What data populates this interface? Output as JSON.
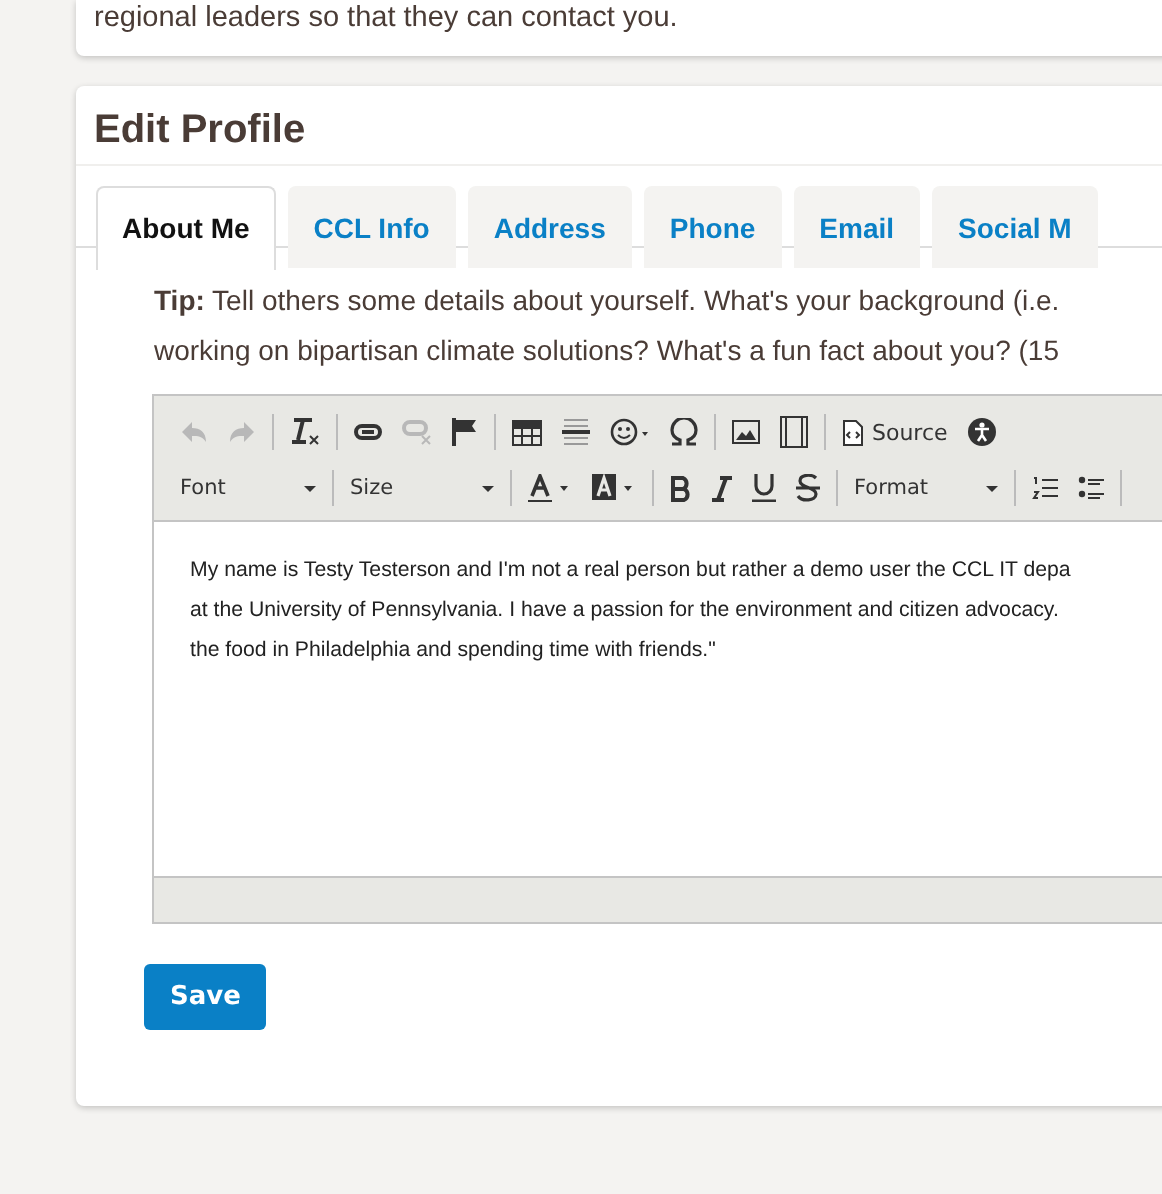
{
  "intro_card": {
    "text": "regional leaders so that they can contact you."
  },
  "edit_profile": {
    "title": "Edit Profile",
    "tabs": [
      {
        "label": "About Me",
        "selected": true
      },
      {
        "label": "CCL Info",
        "selected": false
      },
      {
        "label": "Address",
        "selected": false
      },
      {
        "label": "Phone",
        "selected": false
      },
      {
        "label": "Email",
        "selected": false
      },
      {
        "label": "Social M",
        "selected": false
      }
    ],
    "tip_lines": [
      "**Tip:** Tell others some details about yourself. What's your background (i.e.",
      "working on bipartisan climate solutions? What's a fun fact about you? (15"
    ],
    "editor": {
      "toolbar_row_1": [
        {
          "kind": "undo",
          "disabled": true
        },
        {
          "kind": "redo",
          "disabled": true
        },
        {
          "kind": "sep"
        },
        {
          "kind": "clear-format",
          "disabled": false
        },
        {
          "kind": "sep"
        },
        {
          "kind": "link",
          "disabled": false
        },
        {
          "kind": "unlink",
          "disabled": true
        },
        {
          "kind": "flag",
          "disabled": false
        },
        {
          "kind": "sep"
        },
        {
          "kind": "table",
          "disabled": false
        },
        {
          "kind": "hr",
          "disabled": false
        },
        {
          "kind": "smiley",
          "disabled": false
        },
        {
          "kind": "omega",
          "disabled": false
        },
        {
          "kind": "sep"
        },
        {
          "kind": "image",
          "disabled": false
        },
        {
          "kind": "film",
          "disabled": false
        },
        {
          "kind": "sep"
        },
        {
          "kind": "source",
          "label": "Source",
          "disabled": false
        },
        {
          "kind": "accessibility",
          "disabled": false
        }
      ],
      "toolbar_row_2": [
        {
          "kind": "dropdown",
          "label": "Font"
        },
        {
          "kind": "sep"
        },
        {
          "kind": "dropdown",
          "label": "Size"
        },
        {
          "kind": "sep"
        },
        {
          "kind": "text-color"
        },
        {
          "kind": "bg-color"
        },
        {
          "kind": "sep"
        },
        {
          "kind": "bold"
        },
        {
          "kind": "italic"
        },
        {
          "kind": "underline"
        },
        {
          "kind": "strike"
        },
        {
          "kind": "sep"
        },
        {
          "kind": "dropdown",
          "label": "Format"
        },
        {
          "kind": "sep"
        },
        {
          "kind": "ol"
        },
        {
          "kind": "ul"
        },
        {
          "kind": "sep"
        }
      ],
      "content_lines": [
        "My name is Testy Testerson and I'm not a real person but rather a demo user the CCL IT depa",
        "at the University of Pennsylvania. I have a passion for the environment and citizen advocacy.",
        "the food in Philadelphia and spending time with friends.\""
      ]
    },
    "save_button": "Save"
  }
}
